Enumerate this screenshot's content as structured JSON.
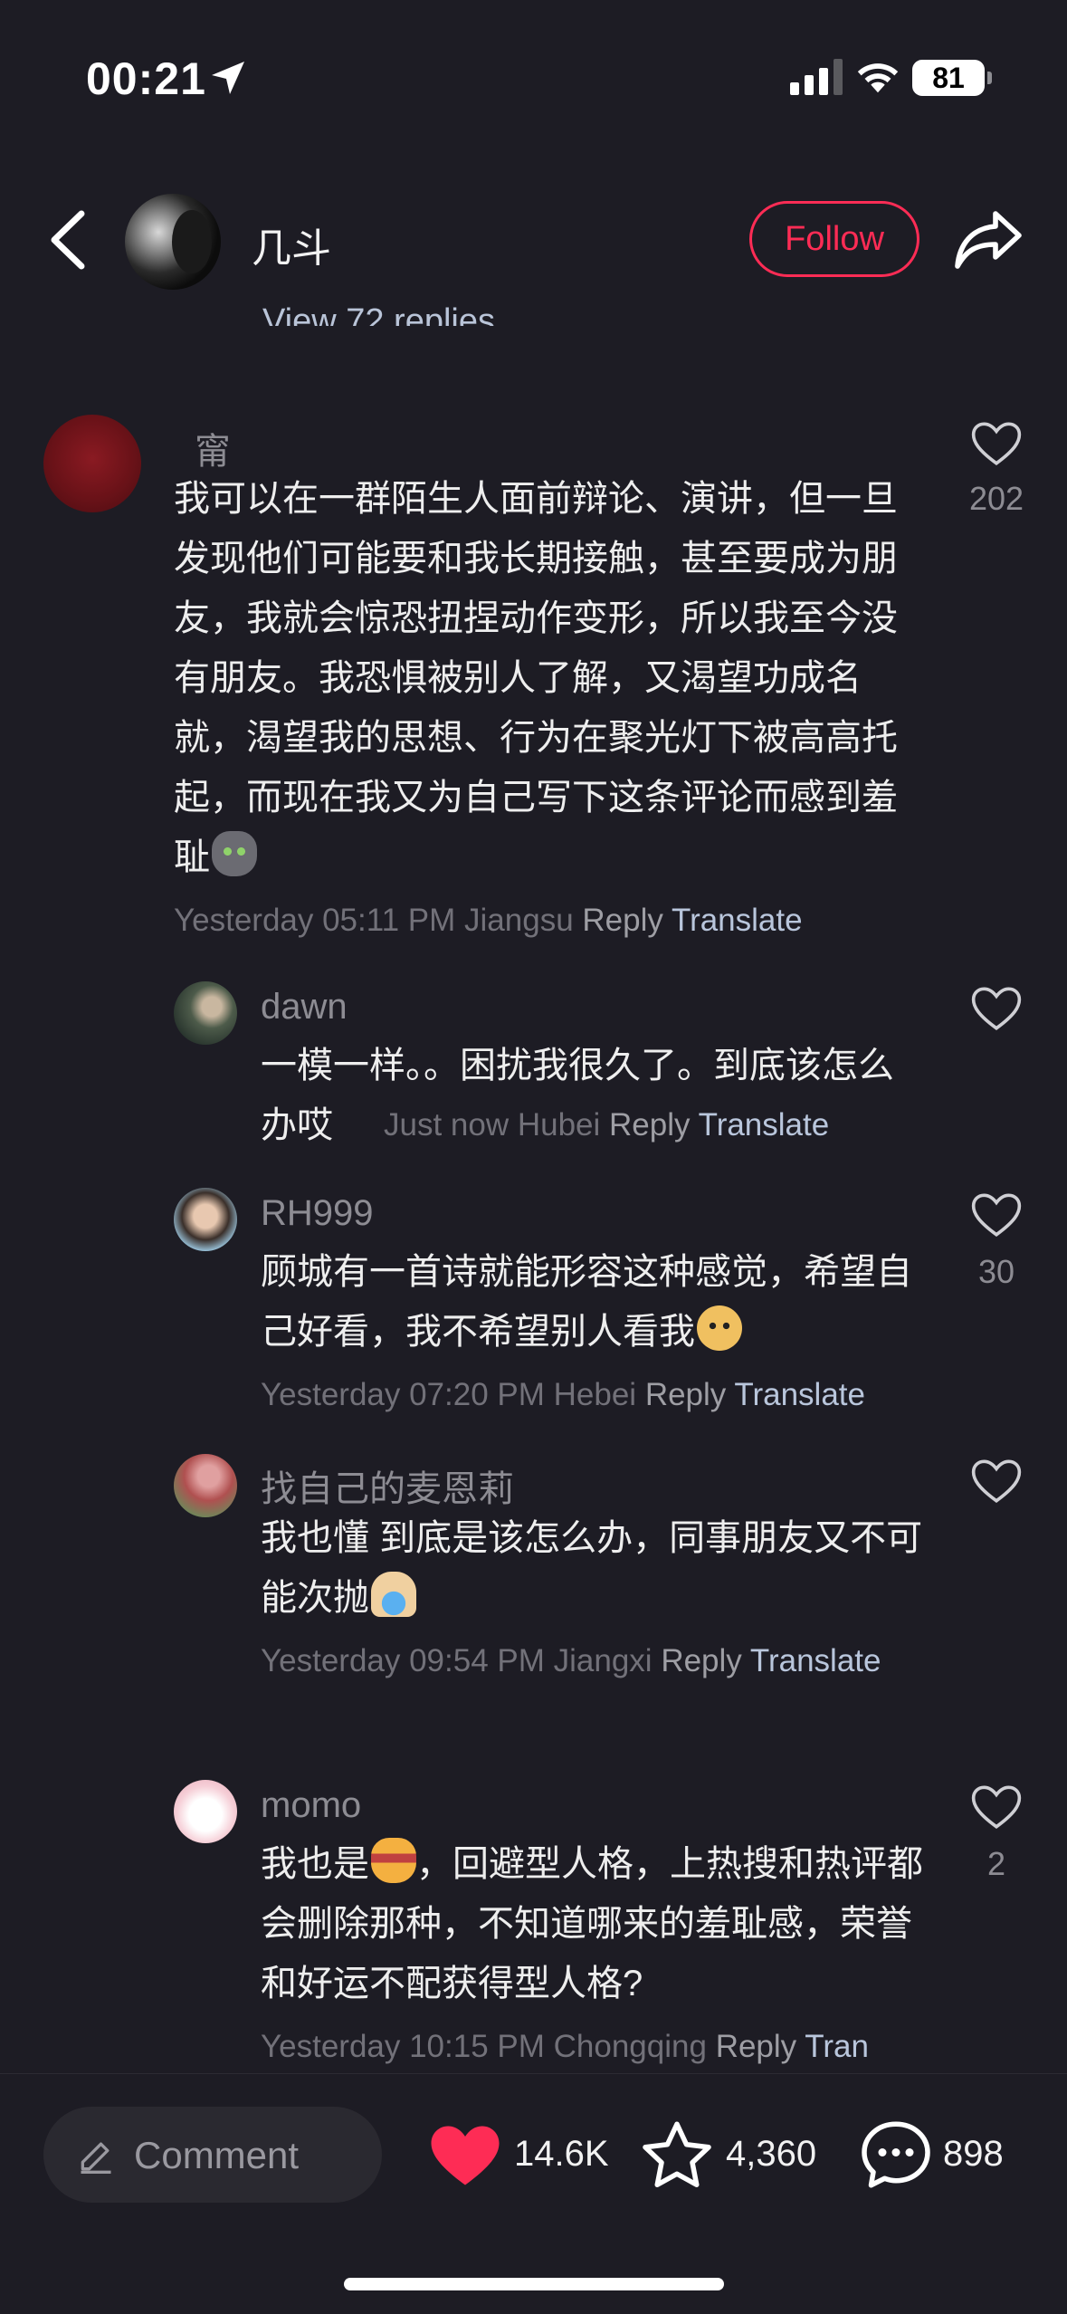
{
  "status": {
    "time": "00:21",
    "battery": "81"
  },
  "header": {
    "author": "几斗",
    "follow_label": "Follow"
  },
  "partial_replies": "View 72 replies",
  "comments": [
    {
      "user": "甯",
      "text": "我可以在一群陌生人面前辩论、演讲，但一旦发现他们可能要和我长期接触，甚至要成为朋友，我就会惊恐扭捏动作变形，所以我至今没有朋友。我恐惧被别人了解，又渴望功成名就，渴望我的思想、行为在聚光灯下被高高托起，而现在我又为自己写下这条评论而感到羞耻",
      "meta": "Yesterday 05:11 PM Jiangsu",
      "reply": "Reply",
      "translate": "Translate",
      "likes": "202"
    },
    {
      "user": "dawn",
      "text": "一模一样。。困扰我很久了。到底该怎么办哎",
      "meta": "Just now Hubei",
      "reply": "Reply",
      "translate": "Translate",
      "likes": ""
    },
    {
      "user": "RH999",
      "text": "顾城有一首诗就能形容这种感觉，希望自己好看，我不希望别人看我",
      "meta": "Yesterday 07:20 PM Hebei",
      "reply": "Reply",
      "translate": "Translate",
      "likes": "30"
    },
    {
      "user": "找自己的麦恩莉",
      "text": "我也懂 到底是该怎么办，同事朋友又不可能次抛",
      "meta": "Yesterday 09:54 PM Jiangxi",
      "reply": "Reply",
      "translate": "Translate",
      "likes": ""
    },
    {
      "user": "momo",
      "text_a": "我也是",
      "text_b": "，回避型人格，上热搜和热评都会删除那种，不知道哪来的羞耻感，荣誉和好运不配获得型人格?",
      "meta": "Yesterday 10:15 PM Chongqing",
      "reply": "Reply",
      "translate": "Tran",
      "likes": "2"
    }
  ],
  "bottom": {
    "comment_placeholder": "Comment",
    "likes": "14.6K",
    "favorites": "4,360",
    "comments": "898"
  },
  "colors": {
    "accent": "#fe2c55",
    "background": "#1d1c24",
    "translate": "#b9c6dc"
  }
}
